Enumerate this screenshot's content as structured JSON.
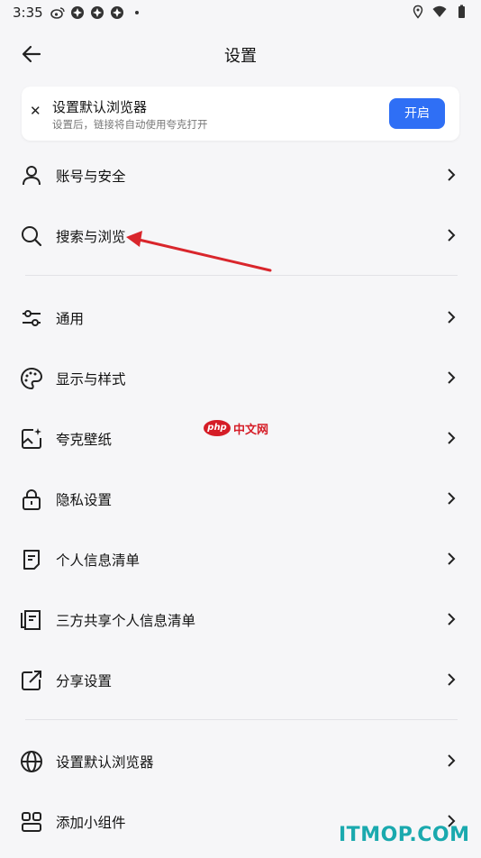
{
  "status_bar": {
    "time": "3:35",
    "left_icons": [
      "weibo-icon",
      "app-icon",
      "app-icon",
      "app-icon",
      "dot-icon"
    ],
    "right_icons": [
      "location-icon",
      "wifi-icon",
      "battery-icon"
    ]
  },
  "header": {
    "title": "设置"
  },
  "banner": {
    "title": "设置默认浏览器",
    "description": "设置后，链接将自动使用夸克打开",
    "button": "开启"
  },
  "settings": [
    {
      "icon": "user-icon",
      "label": "账号与安全"
    },
    {
      "icon": "search-icon",
      "label": "搜索与浏览"
    },
    {
      "icon": "sliders-icon",
      "label": "通用"
    },
    {
      "icon": "palette-icon",
      "label": "显示与样式"
    },
    {
      "icon": "wallpaper-icon",
      "label": "夸克壁纸"
    },
    {
      "icon": "lock-icon",
      "label": "隐私设置"
    },
    {
      "icon": "document-icon",
      "label": "个人信息清单"
    },
    {
      "icon": "shared-document-icon",
      "label": "三方共享个人信息清单"
    },
    {
      "icon": "share-icon",
      "label": "分享设置"
    },
    {
      "icon": "globe-icon",
      "label": "设置默认浏览器"
    },
    {
      "icon": "widgets-icon",
      "label": "添加小组件"
    }
  ],
  "overlays": {
    "php_logo_mark": "php",
    "php_logo_text": "中文网",
    "watermark": "ITMOP.COM"
  },
  "colors": {
    "accent": "#2f6ff5",
    "background": "#f6f6f8",
    "annotation_arrow": "#d9262c"
  }
}
